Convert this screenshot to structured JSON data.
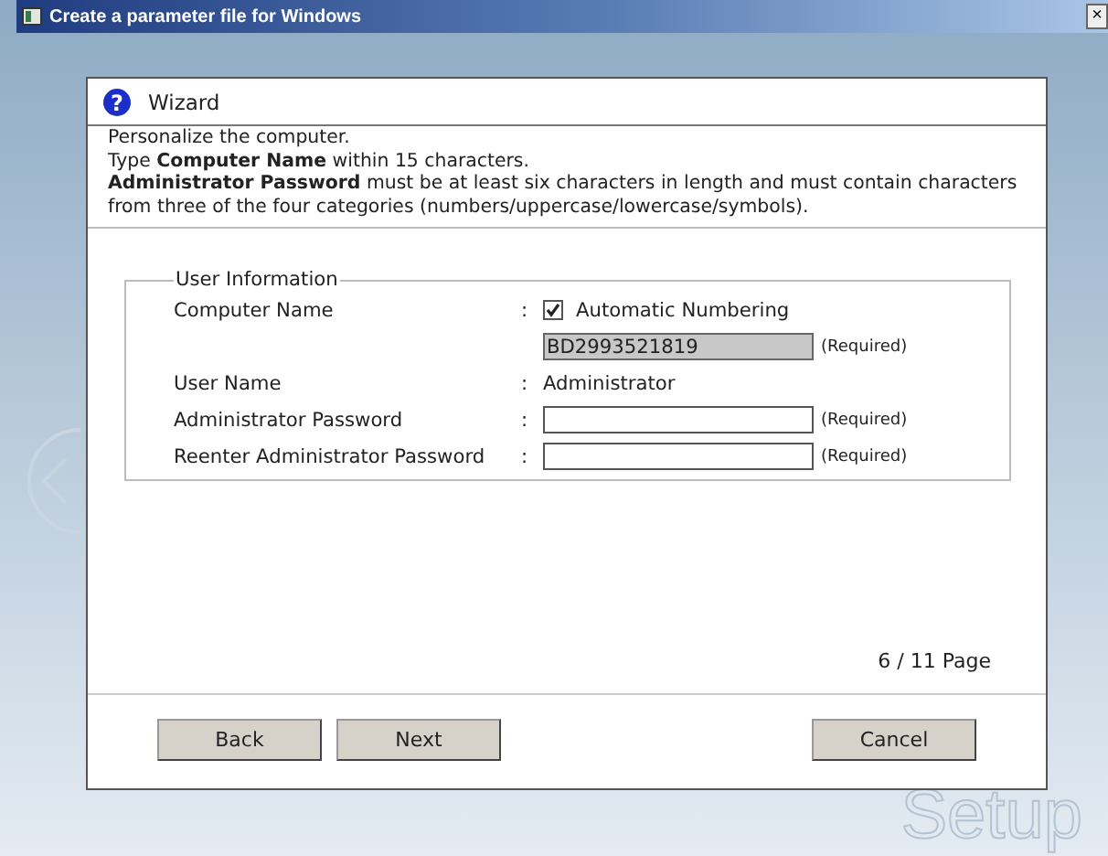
{
  "window": {
    "title": "Create a parameter file for Windows",
    "close": "×"
  },
  "background_text": "Setup",
  "wizard": {
    "help_icon": "?",
    "title": "Wizard",
    "description": [
      "Personalize the computer.",
      "Type **Computer Name** within 15 characters.",
      "**Administrator Password** must be at least six characters in length and must contain characters from three of the four categories (numbers/uppercase/lowercase/symbols)."
    ],
    "group": {
      "title": "User Information",
      "rows": [
        {
          "kind": "checkbox",
          "label": "Computer Name",
          "separator": ":",
          "option": "Automatic Numbering",
          "checked": true
        },
        {
          "kind": "input",
          "value": "BD2993521819",
          "disabled": true,
          "note": "(Required)"
        },
        {
          "kind": "text",
          "label": "User Name",
          "separator": ":",
          "value": "Administrator"
        },
        {
          "kind": "input",
          "label": "Administrator Password",
          "separator": ":",
          "value": "",
          "disabled": false,
          "note": "(Required)"
        },
        {
          "kind": "input",
          "label": "Reenter Administrator Password",
          "separator": ":",
          "value": "",
          "disabled": false,
          "note": "(Required)"
        }
      ]
    },
    "page_indicator": "6 / 11 Page",
    "buttons": {
      "left": [
        "Back",
        "Next"
      ],
      "right": [
        "Cancel"
      ]
    }
  }
}
